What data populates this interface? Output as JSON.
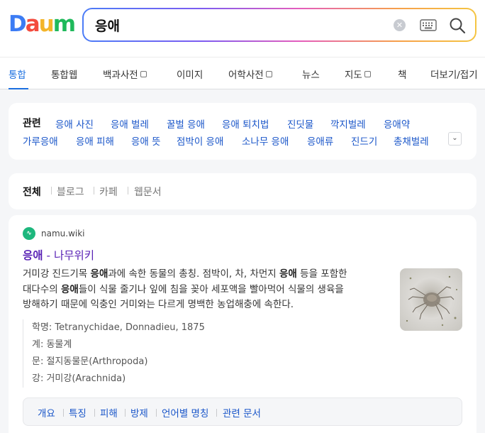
{
  "logo": {
    "text": "Daum",
    "colors": [
      "#3c7cf4",
      "#f34b3e",
      "#f3b52a",
      "#1fb95b"
    ]
  },
  "search": {
    "query": "응애",
    "icons": [
      "clear-icon",
      "keyboard-icon",
      "search-icon"
    ]
  },
  "tabs": [
    {
      "label": "통합",
      "active": true
    },
    {
      "label": "통합웹"
    },
    {
      "label": "백과사전",
      "box": true
    },
    {
      "label": "이미지"
    },
    {
      "label": "어학사전",
      "box": true
    },
    {
      "label": "뉴스"
    },
    {
      "label": "지도",
      "box": true
    },
    {
      "label": "책"
    },
    {
      "label": "더보기/접기"
    }
  ],
  "related": {
    "title": "관련",
    "row1": [
      "응애 사진",
      "응애 벌레",
      "꿀벌 응애",
      "응애 퇴치법",
      "진딧물",
      "깍지벌레",
      "응애약"
    ],
    "row2": [
      "가루응애",
      "응애 피해",
      "응애 뜻",
      "점박이 응애",
      "소나무 응애",
      "응애류",
      "진드기",
      "총채벌레"
    ],
    "toggle_icon": "chevron-down-icon"
  },
  "filters": [
    "전체",
    "블로그",
    "카페",
    "웹문서"
  ],
  "result": {
    "site": "namu.wiki",
    "title_keyword": "응애",
    "title_rest": " - 나무위키",
    "desc_lines": [
      [
        "거미강 진드기목 ",
        "응애",
        "과에 속한 동물의 총칭. 점박이, 차, 차먼지 ",
        "응애",
        " 등을 포함한"
      ],
      [
        "대다수의 ",
        "응애",
        "들이 식물 줄기나 잎에 침을 꽂아 세포액을 빨아먹어 식물의 생육을"
      ],
      [
        "방해하기 때문에 익충인 거미와는 다르게 명백한 농업해충에 속한다.",
        "",
        "",
        "",
        ""
      ]
    ],
    "info": [
      "학명: Tetranychidae, Donnadieu, 1875",
      "계: 동물계",
      "문: 절지동물문(Arthropoda)",
      "강: 거미강(Arachnida)"
    ],
    "sublinks": [
      "개요",
      "특징",
      "피해",
      "방제",
      "언어별 명칭",
      "관련 문서"
    ]
  },
  "colors": {
    "accent": "#1b6fe0",
    "link": "#1a56c9",
    "visited": "#5922b5"
  }
}
